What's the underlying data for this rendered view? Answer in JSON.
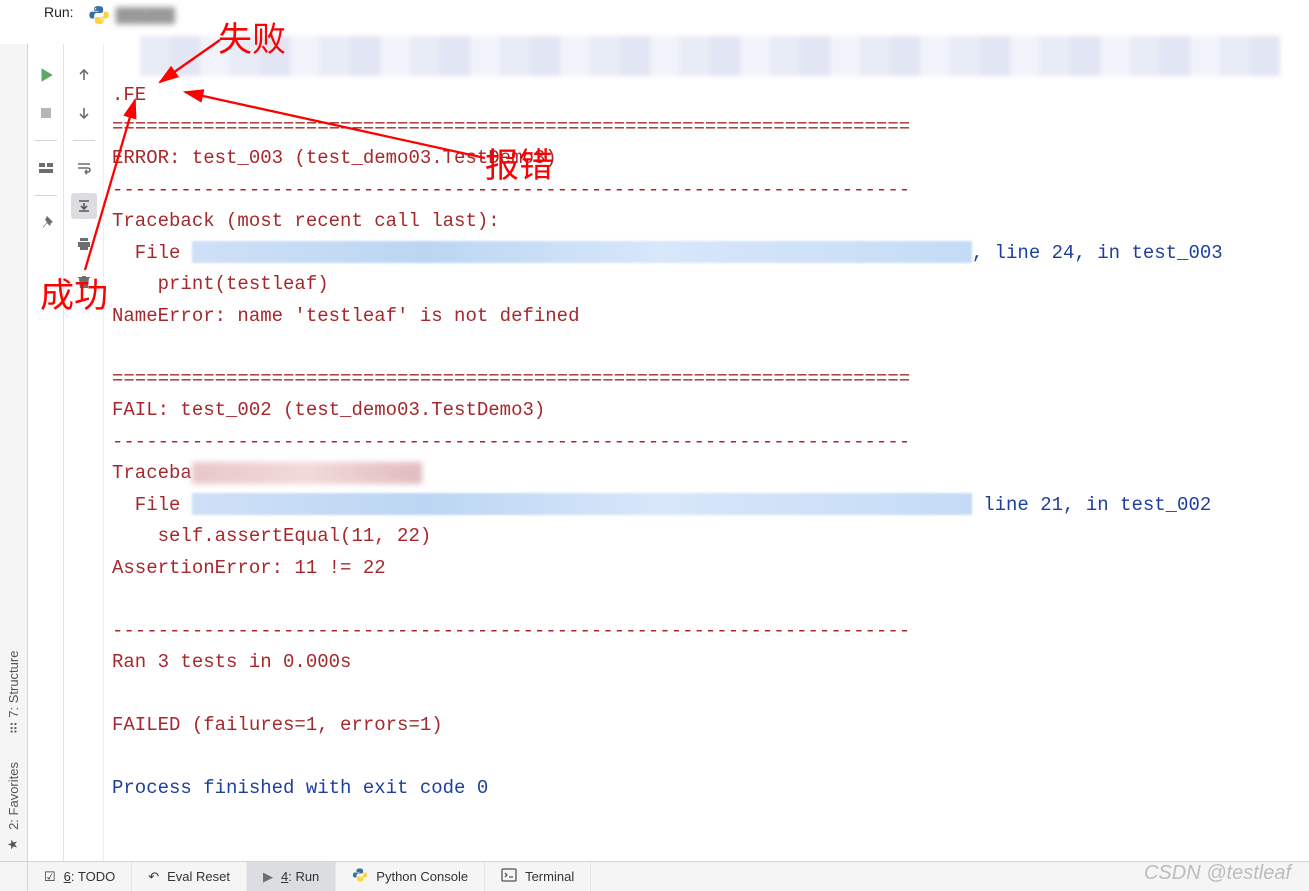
{
  "topbar": {
    "label": "Run:"
  },
  "sidebar_left": {
    "structure": "7: Structure",
    "favorites": "2: Favorites"
  },
  "console": {
    "fe": ".FE",
    "sep70": "======================================================================",
    "error_hdr": "ERROR: test_003 (test_demo03.TestDemo3)",
    "dash70": "----------------------------------------------------------------------",
    "traceback": "Traceback (most recent call last):",
    "file_indent": "  File ",
    "line24": ", line 24, in test_003",
    "print_ln": "    print(testleaf)",
    "nameerr": "NameError: name 'testleaf' is not defined",
    "fail_hdr": "FAIL: test_002 (test_demo03.TestDemo3)",
    "traceb": "Traceba",
    "line21": " line 21, in test_002",
    "assert_ln": "    self.assertEqual(11, 22)",
    "asserterr": "AssertionError: 11 != 22",
    "ran": "Ran 3 tests in 0.000s",
    "failed": "FAILED (failures=1, errors=1)",
    "exit": "Process finished with exit code 0"
  },
  "bottom_tabs": {
    "todo_u": "6",
    "todo": ": TODO",
    "eval": "Eval Reset",
    "run_u": "4",
    "run": ": Run",
    "pyc": "Python Console",
    "term": "Terminal"
  },
  "annotations": {
    "fail": "失败",
    "error": "报错",
    "success": "成功"
  },
  "watermark": "CSDN @testleaf"
}
